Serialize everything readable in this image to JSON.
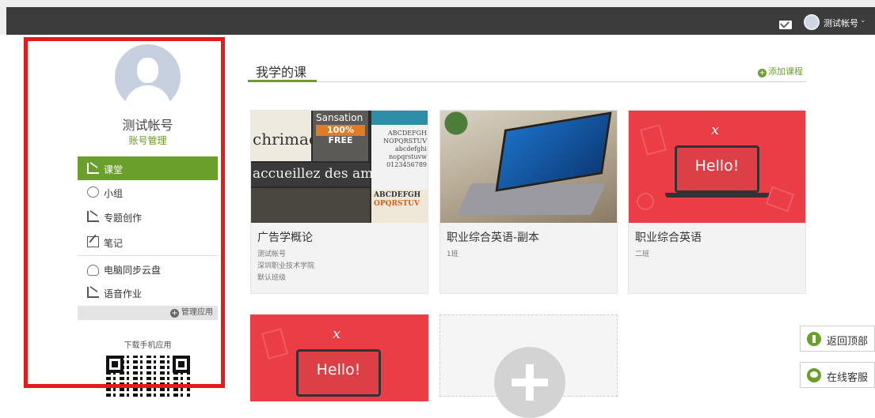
{
  "header": {
    "user_name": "测试帐号",
    "caret": "⌄"
  },
  "sidebar": {
    "profile_name": "测试帐号",
    "account_link": "账号管理",
    "items": [
      {
        "label": "课堂",
        "active": true
      },
      {
        "label": "小组"
      },
      {
        "label": "专题创作"
      },
      {
        "label": "笔记"
      },
      {
        "label": "电脑同步云盘"
      },
      {
        "label": "语音作业"
      }
    ],
    "manage_label": "管理应用",
    "download_label": "下载手机应用"
  },
  "main": {
    "section_title": "我学的课",
    "add_course": "添加课程",
    "courses": [
      {
        "title": "广告学概论",
        "meta": [
          "测试帐号",
          "深圳职业技术学院",
          "默认班级"
        ]
      },
      {
        "title": "职业综合英语-副本",
        "meta": [
          "1班"
        ]
      },
      {
        "title": "职业综合英语",
        "meta": [
          "二班"
        ]
      }
    ],
    "thumb_text": {
      "fonts_a": "chrimae",
      "fonts_b1": "Sansation",
      "fonts_b2": "100% FREE",
      "fonts_c": "ABCDEFGH NOPQRSTUV abcdefghi nopqrstuvw 0123456789",
      "fonts_d": "accueillez des amis",
      "fonts_f1": "ABCDEFGH",
      "fonts_f2": "OPQRSTUV",
      "hello": "Hello!",
      "hello_mark": "x"
    }
  },
  "float": {
    "back_to_top": "返回顶部",
    "online_service": "在线客服"
  },
  "colors": {
    "accent": "#6a9f2c",
    "highlight_frame": "#e21b1b",
    "topbar": "#3c3c3c"
  }
}
